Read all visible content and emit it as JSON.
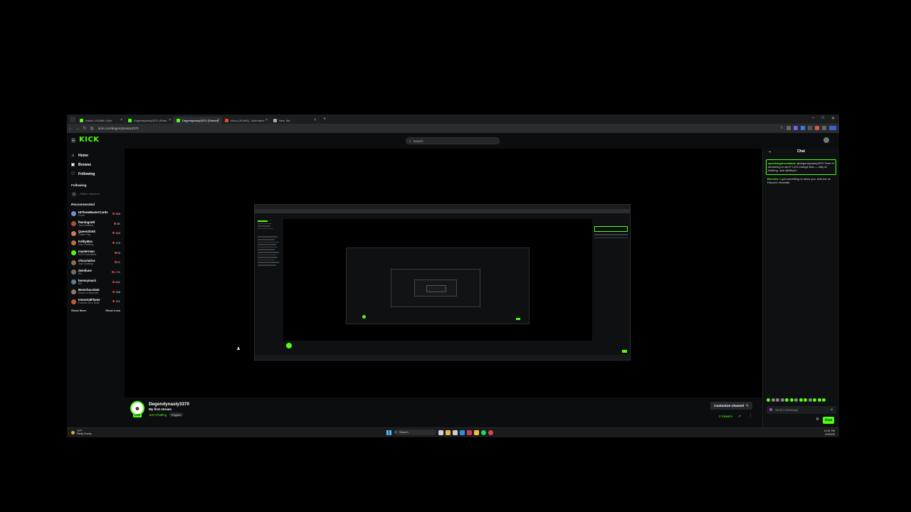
{
  "browser": {
    "tabs": [
      {
        "label": "Inside | Sf1588 | Kick",
        "color": "#53fc18"
      },
      {
        "label": "Degendynasty3370 (Ride)",
        "color": "#53fc18"
      },
      {
        "label": "Degendynasty3370 (Stream)",
        "color": "#53fc18"
      },
      {
        "label": "Inbox (30,695) - killerman4",
        "color": "#ea4335"
      },
      {
        "label": "New Tab",
        "color": "#aaaaaa"
      }
    ],
    "new_tab": "+",
    "url": "kick.com/degendynasty3370",
    "window_controls": [
      "–",
      "□",
      "✕"
    ]
  },
  "kick": {
    "logo": "KICK",
    "search_placeholder": "Search",
    "nav": [
      {
        "label": "Home",
        "icon": "home-icon",
        "glyph": "⌂"
      },
      {
        "label": "Browse",
        "icon": "browse-icon",
        "glyph": "▣"
      },
      {
        "label": "Following",
        "icon": "heart-icon",
        "glyph": "♡"
      }
    ],
    "following_title": "Following",
    "following_placeholder": "Offline streamer",
    "recommended_title": "Recommended",
    "recommended": [
      {
        "name": "HITbowMasterCards",
        "category": "Dorm",
        "viewers": "900",
        "color": "#7a8cd6"
      },
      {
        "name": "flamingodd",
        "category": "Just Chatting",
        "viewers": "3K",
        "color": "#b24a3f"
      },
      {
        "name": "QueenSloth",
        "category": "Dollar Pixy",
        "viewers": "403",
        "color": "#c77d55"
      },
      {
        "name": "KelbyMax",
        "category": "Just Chatting",
        "viewers": "120",
        "color": "#b56f4a"
      },
      {
        "name": "masterman",
        "category": "KICK Downtime",
        "viewers": "53",
        "color": "#53fc18"
      },
      {
        "name": "chocolatice",
        "category": "Just Chatting",
        "viewers": "21",
        "color": "#9a6b46"
      },
      {
        "name": "demilune",
        "category": "IRL",
        "viewers": "1.7K",
        "color": "#7b6c63"
      },
      {
        "name": "benmymack",
        "category": "IRL",
        "viewers": "641",
        "color": "#5c7e9c"
      },
      {
        "name": "Bentchocolate",
        "category": "World of Warcraft",
        "viewers": "188",
        "color": "#8c7a6b"
      },
      {
        "name": "ImmortalFlame",
        "category": "Fortnite Zero Build",
        "viewers": "101",
        "color": "#c25a2e"
      }
    ],
    "show_more": "Show More",
    "show_less": "Show Less"
  },
  "channel": {
    "name": "Degendynasty3370",
    "title": "My first stream",
    "category": "Just Chatting",
    "tag": "English",
    "live_badge": "LIVE",
    "customize_button": "Customize channel",
    "viewers": "0 Viewers"
  },
  "chat": {
    "title": "Chat",
    "pinned_user": "spookingsherstation",
    "pinned_text": "@degendynasty3370 Tired of streaming to zero? Let's change that — stay at Nothing. Just @Wkq3J",
    "message_user": "Benchis:",
    "message_text": "I got something to show you. Add me on Discord: emanata",
    "input_placeholder": "Send a message",
    "send_button": "Chat"
  },
  "taskbar": {
    "weather_temp": "70°F",
    "weather_desc": "Partly Sunny",
    "search_label": "Search",
    "time": "12:51 PM",
    "date": "4/3/2025"
  }
}
